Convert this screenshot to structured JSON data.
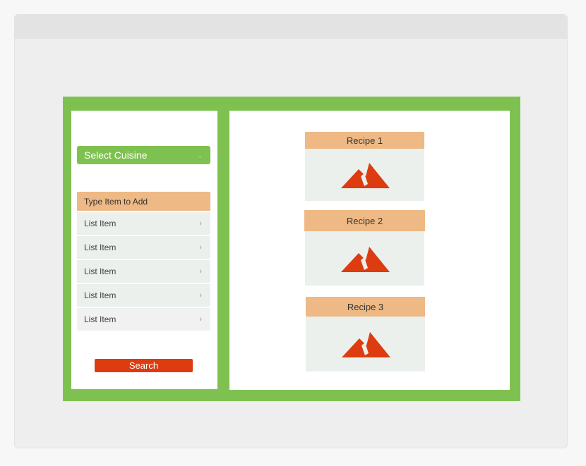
{
  "left_panel": {
    "dropdown": {
      "label": "Select Cuisine",
      "chevron": "⌄"
    },
    "list": {
      "header": "Type Item to Add",
      "items": [
        {
          "label": "List Item",
          "chevron": "›"
        },
        {
          "label": "List Item",
          "chevron": "›"
        },
        {
          "label": "List Item",
          "chevron": "›"
        },
        {
          "label": "List Item",
          "chevron": "›"
        },
        {
          "label": "List Item",
          "chevron": "›"
        }
      ]
    },
    "search_button": {
      "label": "Search"
    }
  },
  "recipes": [
    {
      "title": "Recipe 1",
      "icon": "image-placeholder-icon"
    },
    {
      "title": "Recipe 2",
      "icon": "image-placeholder-icon"
    },
    {
      "title": "Recipe 3",
      "icon": "image-placeholder-icon"
    }
  ],
  "colors": {
    "frame_green": "#7fc150",
    "header_orange": "#eeb985",
    "accent_red": "#dd3b10",
    "panel_bg": "#ebf0ed"
  }
}
